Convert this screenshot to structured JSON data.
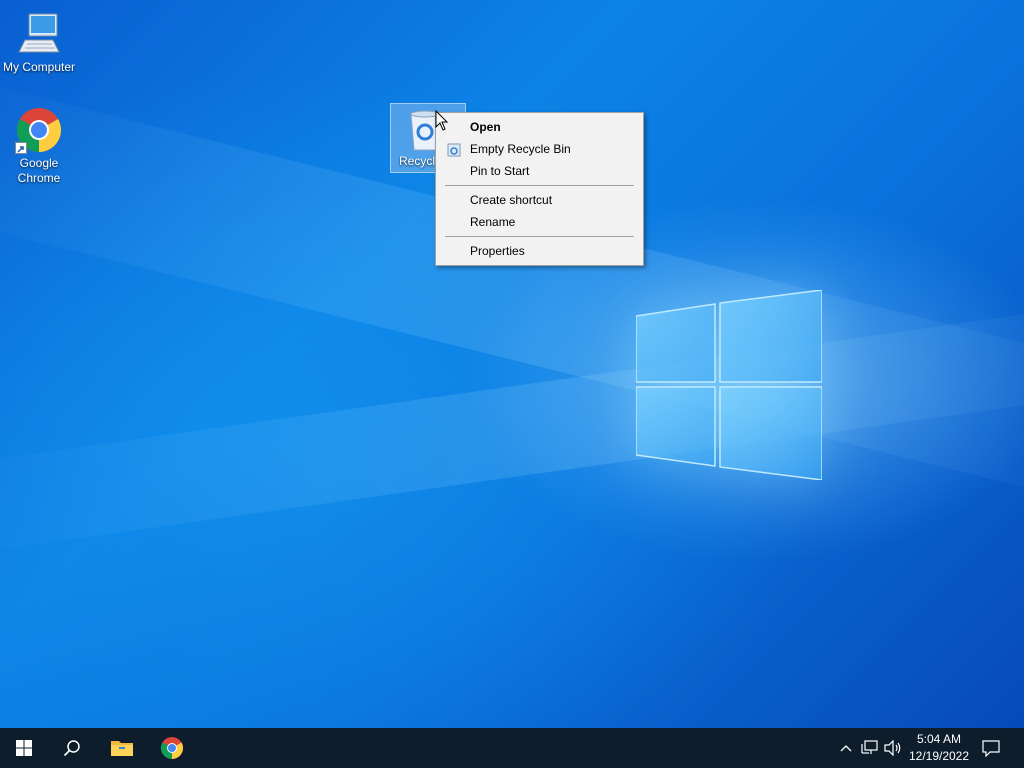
{
  "desktop": {
    "icons": [
      {
        "label": "My Computer"
      },
      {
        "label": "Google Chrome"
      },
      {
        "label": "Recycle Bin"
      }
    ]
  },
  "context_menu": {
    "items": [
      {
        "label": "Open",
        "bold": true
      },
      {
        "label": "Empty Recycle Bin",
        "icon": "recycle-bin-icon"
      },
      {
        "label": "Pin to Start"
      },
      {
        "label": "Create shortcut"
      },
      {
        "label": "Rename"
      },
      {
        "label": "Properties"
      }
    ]
  },
  "taskbar": {
    "buttons": [
      "start-icon",
      "search-icon",
      "file-explorer-icon",
      "chrome-icon"
    ],
    "tray": {
      "icons": [
        "chevron-up-icon",
        "network-icon",
        "volume-icon"
      ],
      "time": "5:04 AM",
      "date": "12/19/2022",
      "notification_icon": "action-center-icon"
    }
  },
  "colors": {
    "taskbar": "#0d1d2c",
    "menu_bg": "#f2f2f2",
    "desktop_accent": "#0a72dc"
  }
}
